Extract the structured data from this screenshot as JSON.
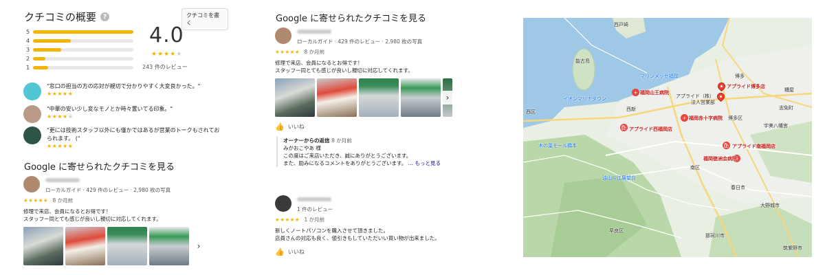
{
  "summary": {
    "title": "クチコミの概要",
    "write_button": "クチコミを書く",
    "rating": "4.0",
    "stars_filled": 4,
    "review_count": "243 件のレビュー",
    "bars": [
      {
        "label": "5",
        "fraction": 1.0
      },
      {
        "label": "4",
        "fraction": 0.38
      },
      {
        "label": "3",
        "fraction": 0.28
      },
      {
        "label": "2",
        "fraction": 0.12
      },
      {
        "label": "1",
        "fraction": 0.15
      }
    ]
  },
  "snippets": [
    {
      "text": "\"窓口の担当の方の応対が親切で分かりやすく大変良かった。\"",
      "stars": 5,
      "avatar_color": "#52c7d3"
    },
    {
      "text": "\"中華の安い少し変なモノとか時々置いてる印象。\"",
      "stars": 4,
      "avatar_color": "#b89a86"
    },
    {
      "text": "\"更には技術スタッフ以外にも僅かではあるが営業のトークもされておられます。 (\"",
      "stars": 5,
      "avatar_color": "#2c5545"
    }
  ],
  "left_section_title": "Google に寄せられたクチコミを見る",
  "left_review": {
    "meta": "ローカルガイド · 429 件のレビュー · 2,980 枚の写真",
    "stars": "★★★★★",
    "time": "8 か月前",
    "body_line1": "修理で来店、会員になるとお得です！",
    "body_line2": "スタッフー同とても感じが良いし親切に対応してくれます。",
    "avatar_color": "#b08a6e"
  },
  "mid_section_title": "Google に寄せられたクチコミを見る",
  "mid_review_1": {
    "meta": "ローカルガイド · 429 件のレビュー · 2,980 枚の写真",
    "stars": "★★★★★",
    "time": "8 か月前",
    "body_line1": "修理で来店、会員になるとお得です！",
    "body_line2": "スタッフー同とても感じが良いし親切に対応してくれます。",
    "like": "いいね",
    "avatar_color": "#b08a6e",
    "owner": {
      "heading": "オーナーからの返信",
      "time": "8 か月前",
      "line1": "みかおこやあ 様",
      "line2": "この度はご来店いただき、誠にありがとうございます。",
      "line3": "また、励みになるコメントをありがとうございます。",
      "more": "… もっと見る"
    }
  },
  "mid_review_2": {
    "meta": "1 件のレビュー",
    "stars": "★★★★★",
    "time": "1 か月前",
    "body_line1": "新しくノートパソコンを購入させて頂きました。",
    "body_line2": "店員さんの対応も良く、値引きもしていただいい買い物が出来ました。",
    "like": "いいね",
    "avatar_color": "#3a3a3a"
  },
  "map": {
    "labels": [
      {
        "text": "西戸崎",
        "cls": ""
      },
      {
        "text": "能古島",
        "cls": ""
      },
      {
        "text": "マリンメッセ福岡",
        "cls": "blue"
      },
      {
        "text": "博多",
        "cls": ""
      },
      {
        "text": "アプライド博多店",
        "cls": "red"
      },
      {
        "text": "アプライド（株）",
        "cls": ""
      },
      {
        "text": "法人営業部",
        "cls": ""
      },
      {
        "text": "福岡山王病院",
        "cls": "red"
      },
      {
        "text": "イオンマリナタウン",
        "cls": "blue"
      },
      {
        "text": "西新",
        "cls": ""
      },
      {
        "text": "アプライド西福岡店",
        "cls": "red"
      },
      {
        "text": "福岡赤十字病院",
        "cls": "red"
      },
      {
        "text": "博多区",
        "cls": ""
      },
      {
        "text": "西区",
        "cls": ""
      },
      {
        "text": "木の葉モール橋本",
        "cls": "blue"
      },
      {
        "text": "アプライド南福岡店",
        "cls": "red"
      },
      {
        "text": "南区",
        "cls": ""
      },
      {
        "text": "福岡徳洲会病院",
        "cls": "red"
      },
      {
        "text": "油山片江展望台",
        "cls": "blue"
      },
      {
        "text": "春日市",
        "cls": ""
      },
      {
        "text": "大野城市",
        "cls": ""
      },
      {
        "text": "早良区",
        "cls": ""
      },
      {
        "text": "那珂川市",
        "cls": ""
      },
      {
        "text": "筑紫野市",
        "cls": ""
      },
      {
        "text": "志免町",
        "cls": ""
      },
      {
        "text": "宇美八幡宮",
        "cls": ""
      },
      {
        "text": "糟屋",
        "cls": ""
      }
    ]
  }
}
